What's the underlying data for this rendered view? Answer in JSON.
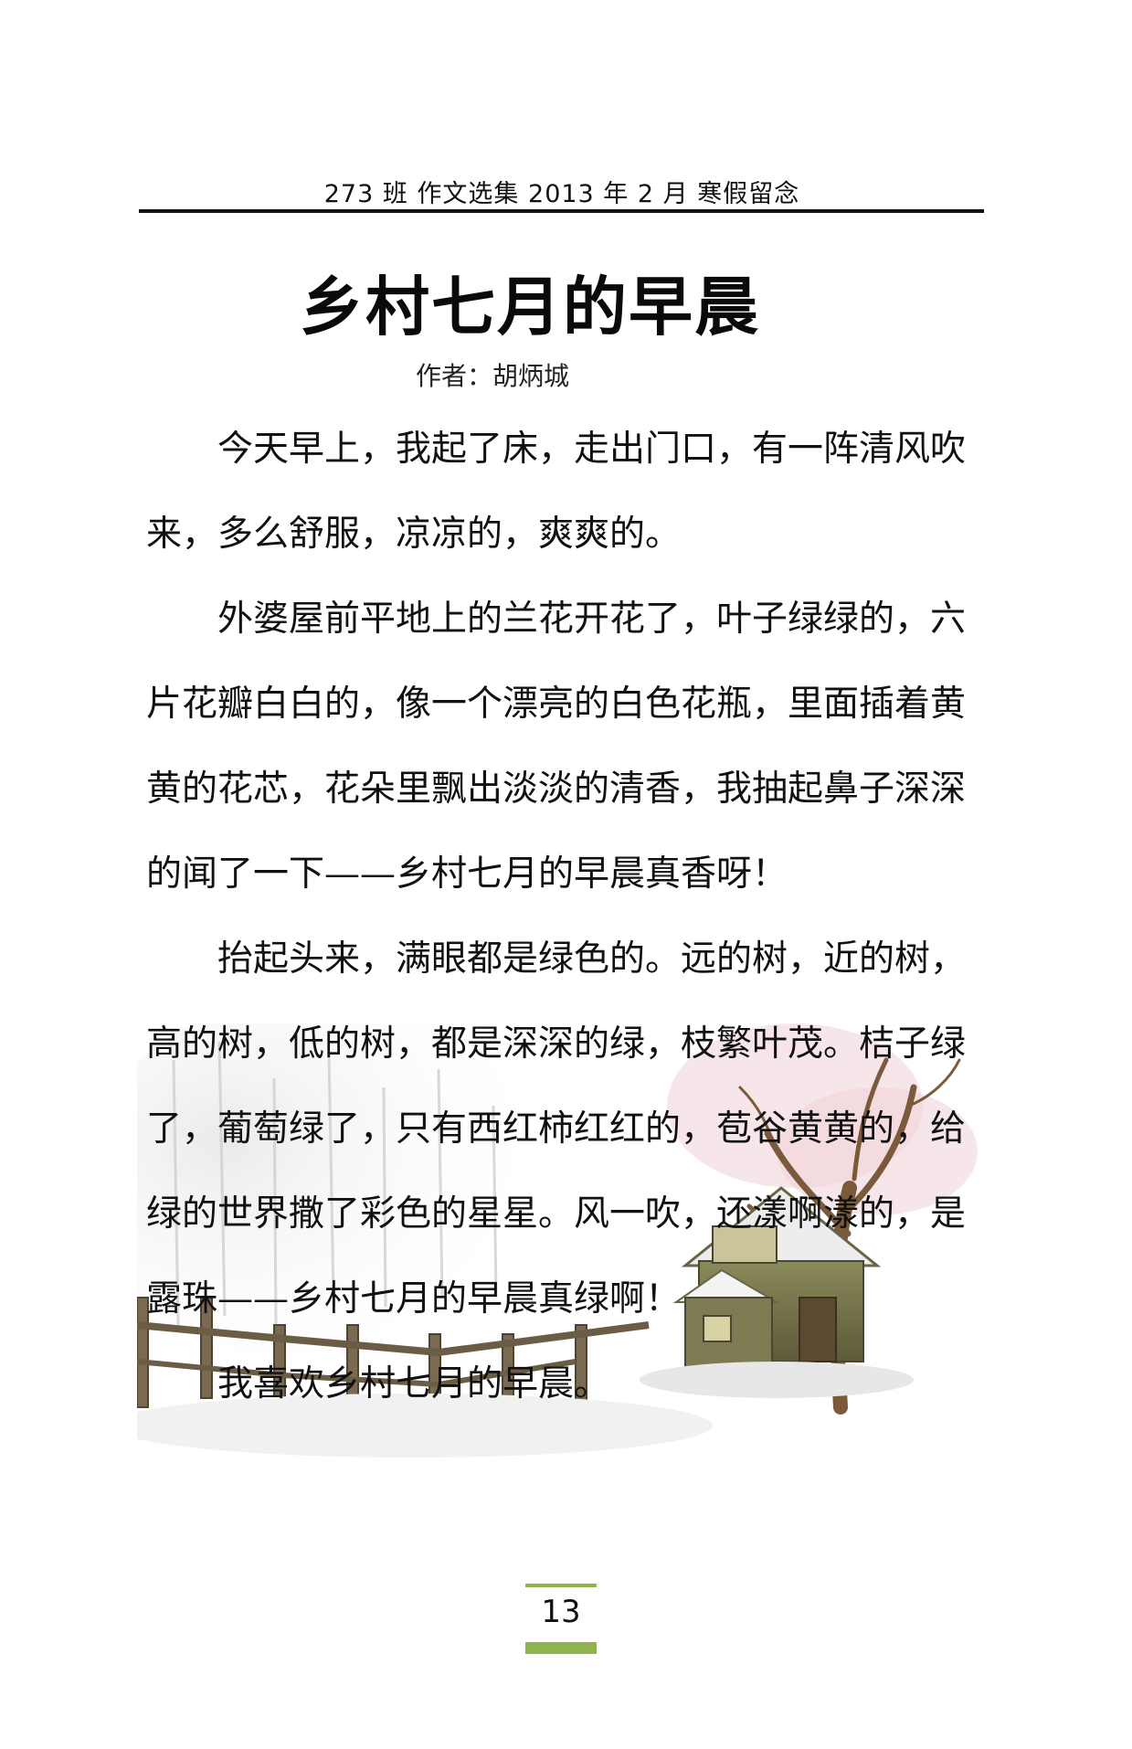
{
  "header": {
    "text": "273 班 作文选集 2013 年 2 月 寒假留念"
  },
  "title": "乡村七月的早晨",
  "author": "作者：胡炳城",
  "paragraphs": [
    "今天早上，我起了床，走出门口，有一阵清风吹来，多么舒服，凉凉的，爽爽的。",
    "外婆屋前平地上的兰花开花了，叶子绿绿的，六片花瓣白白的，像一个漂亮的白色花瓶，里面插着黄黄的花芯，花朵里飘出淡淡的清香，我抽起鼻子深深的闻了一下——乡村七月的早晨真香呀！",
    "抬起头来，满眼都是绿色的。远的树，近的树，高的树，低的树，都是深深的绿，枝繁叶茂。桔子绿了，葡萄绿了，只有西红柿红红的，苞谷黄黄的，给绿的世界撒了彩色的星星。风一吹，还漾啊漾的，是露珠——乡村七月的早晨真绿啊！",
    "我喜欢乡村七月的早晨。"
  ],
  "footer": {
    "page_number": "13",
    "accent_color": "#8fb54a"
  },
  "illustration": {
    "icon": "winter-cottage-illustration"
  }
}
